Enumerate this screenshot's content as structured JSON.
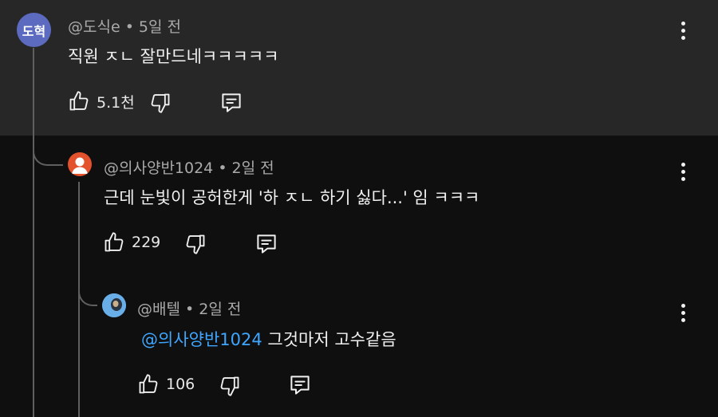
{
  "comments": [
    {
      "avatar_text": "도혁",
      "avatar_color": "#5c6bc0",
      "meta": "@도식e • 5일 전",
      "text": "직원 ㅈㄴ 잘만드네ㅋㅋㅋㅋㅋ",
      "likes": "5.1천"
    },
    {
      "avatar_icon": "person-avatar-icon",
      "avatar_color": "#e4512d",
      "meta": "@의사양반1024 • 2일 전",
      "text": "근데 눈빛이 공허한게 '하 ㅈㄴ 하기 싫다...' 임 ㅋㅋㅋ",
      "likes": "229"
    },
    {
      "avatar_icon": "photo-avatar-icon",
      "avatar_color": "#6aaee8",
      "meta": "@배텔 • 2일 전",
      "mention": "@의사양반1024",
      "text": " 그것마저 고수같음",
      "likes": "106"
    }
  ],
  "colors": {
    "top_bg": "#272727",
    "page_bg": "#0f0f0f",
    "mention": "#3ea6ff",
    "meta": "#aaaaaa"
  }
}
